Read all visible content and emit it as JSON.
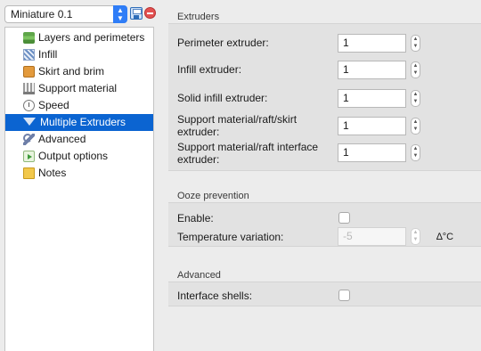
{
  "preset": {
    "selected": "Miniature 0.1"
  },
  "tree": {
    "items": [
      {
        "label": "Layers and perimeters",
        "icon": "layers-icon"
      },
      {
        "label": "Infill",
        "icon": "infill-icon"
      },
      {
        "label": "Skirt and brim",
        "icon": "skirt-brim-icon"
      },
      {
        "label": "Support material",
        "icon": "support-material-icon"
      },
      {
        "label": "Speed",
        "icon": "speed-icon"
      },
      {
        "label": "Multiple Extruders",
        "icon": "funnel-icon",
        "selected": true
      },
      {
        "label": "Advanced",
        "icon": "wrench-icon"
      },
      {
        "label": "Output options",
        "icon": "output-options-icon"
      },
      {
        "label": "Notes",
        "icon": "notes-icon"
      }
    ]
  },
  "extruders": {
    "title": "Extruders",
    "perimeter": {
      "label": "Perimeter extruder:",
      "value": "1"
    },
    "infill": {
      "label": "Infill extruder:",
      "value": "1"
    },
    "solid_infill": {
      "label": "Solid infill extruder:",
      "value": "1"
    },
    "support": {
      "label_line1": "Support material/raft/skirt",
      "label_line2": "extruder:",
      "value": "1"
    },
    "support_interface": {
      "label_line1": "Support material/raft interface",
      "label_line2": "extruder:",
      "value": "1"
    }
  },
  "ooze": {
    "title": "Ooze prevention",
    "enable": {
      "label": "Enable:",
      "checked": false
    },
    "temperature": {
      "label": "Temperature variation:",
      "value": "-5",
      "unit": "∆°C"
    }
  },
  "advanced": {
    "title": "Advanced",
    "interface_shells": {
      "label": "Interface shells:",
      "checked": false
    }
  },
  "colors": {
    "selection": "#0b64d1",
    "select_accent": "#2f7df7",
    "panel_background": "#ececec",
    "group_background": "#e2e2e2"
  }
}
